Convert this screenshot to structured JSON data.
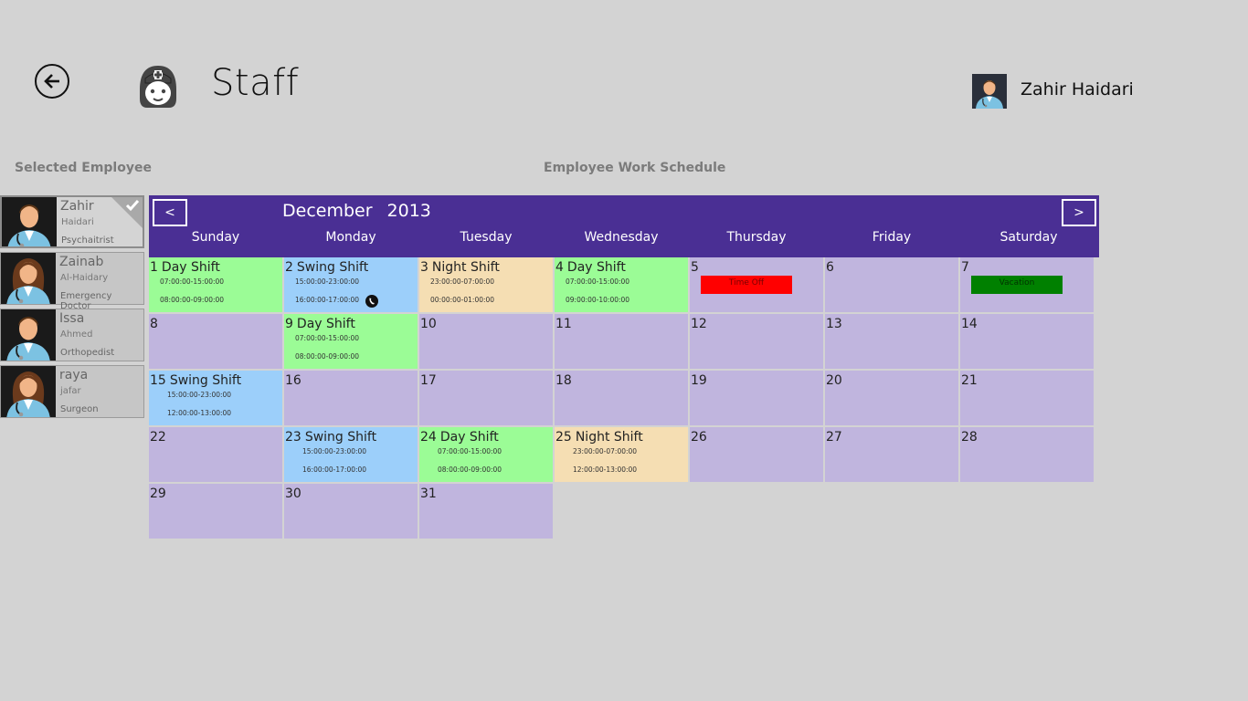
{
  "header": {
    "title": "Staff",
    "user_name": "Zahir Haidari"
  },
  "labels": {
    "selected_employee": "Selected Employee",
    "work_schedule": "Employee Work Schedule"
  },
  "employees": [
    {
      "first": "Zahir",
      "last": "Haidari",
      "role": "Psychaitrist",
      "selected": true
    },
    {
      "first": "Zainab",
      "last": "Al-Haidary",
      "role": "Emergency Doctor",
      "selected": false
    },
    {
      "first": "Issa",
      "last": "Ahmed",
      "role": "Orthopedist",
      "selected": false
    },
    {
      "first": "raya",
      "last": "jafar",
      "role": "Surgeon",
      "selected": false
    }
  ],
  "calendar": {
    "month": "December",
    "year": "2013",
    "prev_label": "<",
    "next_label": ">",
    "weekdays": [
      "Sunday",
      "Monday",
      "Tuesday",
      "Wednesday",
      "Thursday",
      "Friday",
      "Saturday"
    ],
    "days": [
      {
        "day": "1",
        "shift": "Day Shift",
        "type": "day",
        "time1": "07:00:00-15:00:00",
        "time2": "08:00:00-09:00:00"
      },
      {
        "day": "2",
        "shift": "Swing Shift",
        "type": "swing",
        "time1": "15:00:00-23:00:00",
        "time2": "16:00:00-17:00:00"
      },
      {
        "day": "3",
        "shift": "Night Shift",
        "type": "night",
        "time1": "23:00:00-07:00:00",
        "time2": "00:00:00-01:00:00"
      },
      {
        "day": "4",
        "shift": "Day Shift",
        "type": "day",
        "time1": "07:00:00-15:00:00",
        "time2": "09:00:00-10:00:00"
      },
      {
        "day": "5",
        "event": "Time Off",
        "event_color": "red"
      },
      {
        "day": "6"
      },
      {
        "day": "7",
        "event": "Vacation",
        "event_color": "green"
      },
      {
        "day": "8"
      },
      {
        "day": "9",
        "shift": "Day Shift",
        "type": "day",
        "time1": "07:00:00-15:00:00",
        "time2": "08:00:00-09:00:00"
      },
      {
        "day": "10"
      },
      {
        "day": "11"
      },
      {
        "day": "12"
      },
      {
        "day": "13"
      },
      {
        "day": "14"
      },
      {
        "day": "15",
        "shift": "Swing Shift",
        "type": "swing",
        "time1": "15:00:00-23:00:00",
        "time2": "12:00:00-13:00:00"
      },
      {
        "day": "16"
      },
      {
        "day": "17"
      },
      {
        "day": "18"
      },
      {
        "day": "19"
      },
      {
        "day": "20"
      },
      {
        "day": "21"
      },
      {
        "day": "22"
      },
      {
        "day": "23",
        "shift": "Swing Shift",
        "type": "swing",
        "time1": "15:00:00-23:00:00",
        "time2": "16:00:00-17:00:00"
      },
      {
        "day": "24",
        "shift": "Day Shift",
        "type": "day",
        "time1": "07:00:00-15:00:00",
        "time2": "08:00:00-09:00:00"
      },
      {
        "day": "25",
        "shift": "Night Shift",
        "type": "night",
        "time1": "23:00:00-07:00:00",
        "time2": "12:00:00-13:00:00"
      },
      {
        "day": "26"
      },
      {
        "day": "27"
      },
      {
        "day": "28"
      },
      {
        "day": "29"
      },
      {
        "day": "30"
      },
      {
        "day": "31"
      }
    ]
  },
  "icons": {
    "back": "back-arrow-icon",
    "app": "nurse-icon",
    "check": "check-icon",
    "phone": "phone-icon"
  },
  "colors": {
    "header_bg": "#4a2f94",
    "day_shift": "#9bfc96",
    "swing_shift": "#9ccffa",
    "night_shift": "#f5deb3",
    "empty_day": "#c0b5de",
    "time_off": "#ff0000",
    "vacation": "#008000"
  }
}
